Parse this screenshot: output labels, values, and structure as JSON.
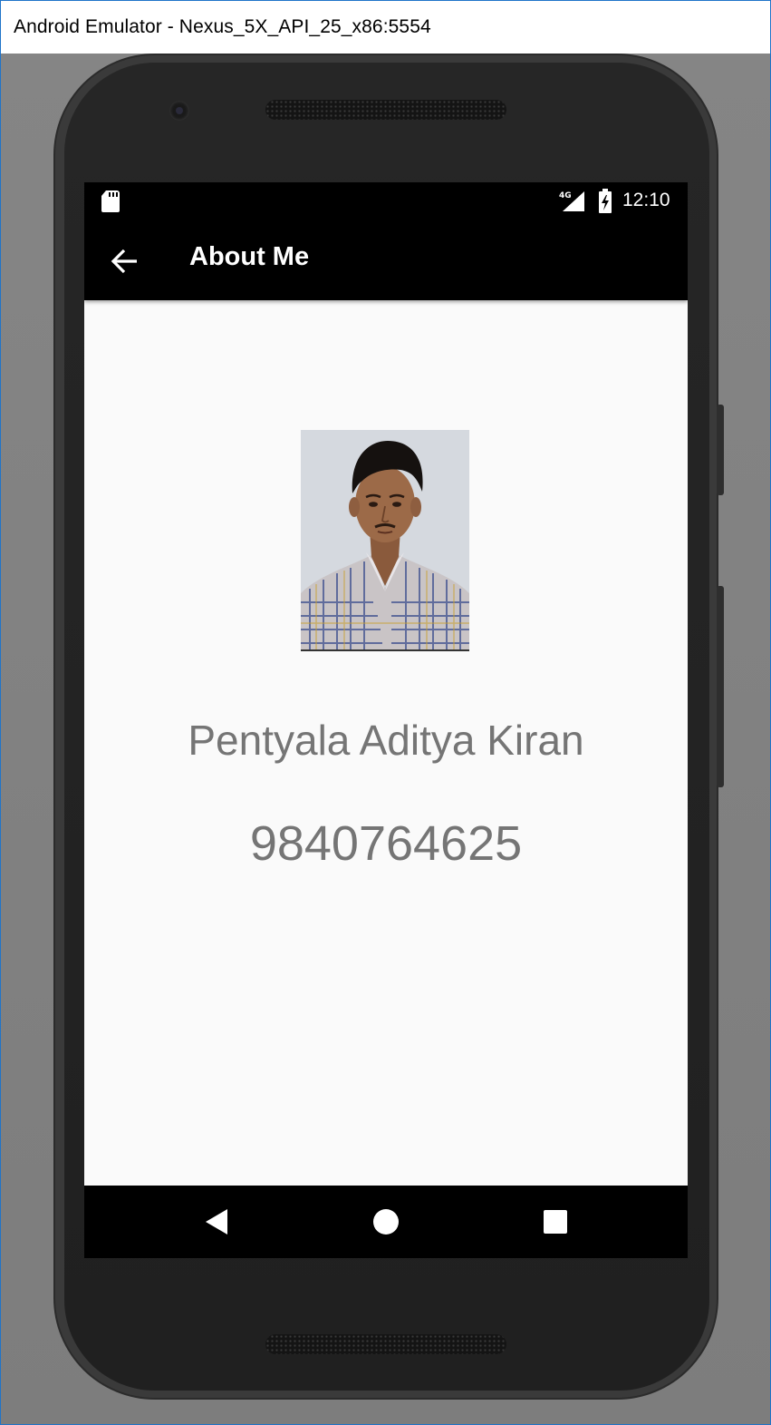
{
  "window": {
    "title": "Android Emulator - Nexus_5X_API_25_x86:5554"
  },
  "statusbar": {
    "icons": [
      "sd-card-icon",
      "network-4g-icon",
      "battery-charging-icon"
    ],
    "network_label": "4G",
    "time": "12:10"
  },
  "appbar": {
    "back_icon": "back-arrow-icon",
    "title": "About Me"
  },
  "profile": {
    "photo": "profile-photo",
    "name": "Pentyala Aditya Kiran",
    "phone": "9840764625"
  },
  "navbar": {
    "icons": [
      "nav-back-icon",
      "nav-home-icon",
      "nav-recents-icon"
    ]
  },
  "colors": {
    "appbar": "#000000",
    "screen_background": "#fafafa",
    "text": "#757575",
    "window_border": "#1f74c9"
  }
}
